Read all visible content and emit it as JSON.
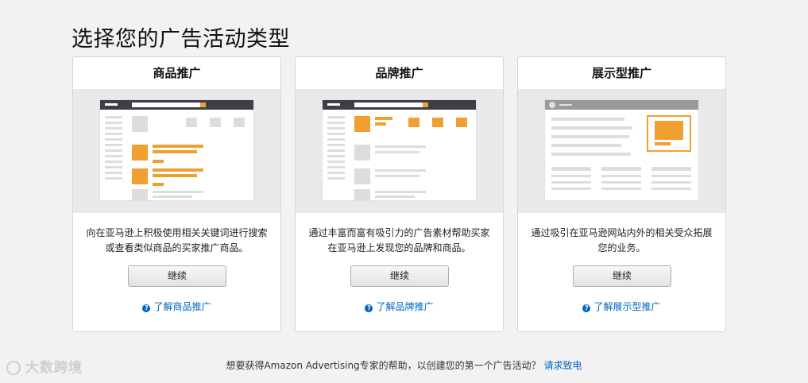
{
  "page": {
    "title": "选择您的广告活动类型"
  },
  "cards": [
    {
      "title": "商品推广",
      "description": "向在亚马逊上积极使用相关关键词进行搜索或查看类似商品的买家推广商品。",
      "button": "继续",
      "learn": "了解商品推广"
    },
    {
      "title": "品牌推广",
      "description": "通过丰富而富有吸引力的广告素材帮助买家在亚马逊上发现您的品牌和商品。",
      "button": "继续",
      "learn": "了解品牌推广"
    },
    {
      "title": "展示型推广",
      "description": "通过吸引在亚马逊网站内外的相关受众拓展您的业务。",
      "button": "继续",
      "learn": "了解展示型推广"
    }
  ],
  "footer": {
    "text": "想要获得Amazon Advertising专家的帮助，以创建您的第一个广告活动？",
    "link": "请求致电"
  },
  "watermark": {
    "text": "大数跨境"
  },
  "colors": {
    "accent": "#f0a030",
    "link": "#0066c0",
    "dark_bar": "#3d3f47"
  }
}
